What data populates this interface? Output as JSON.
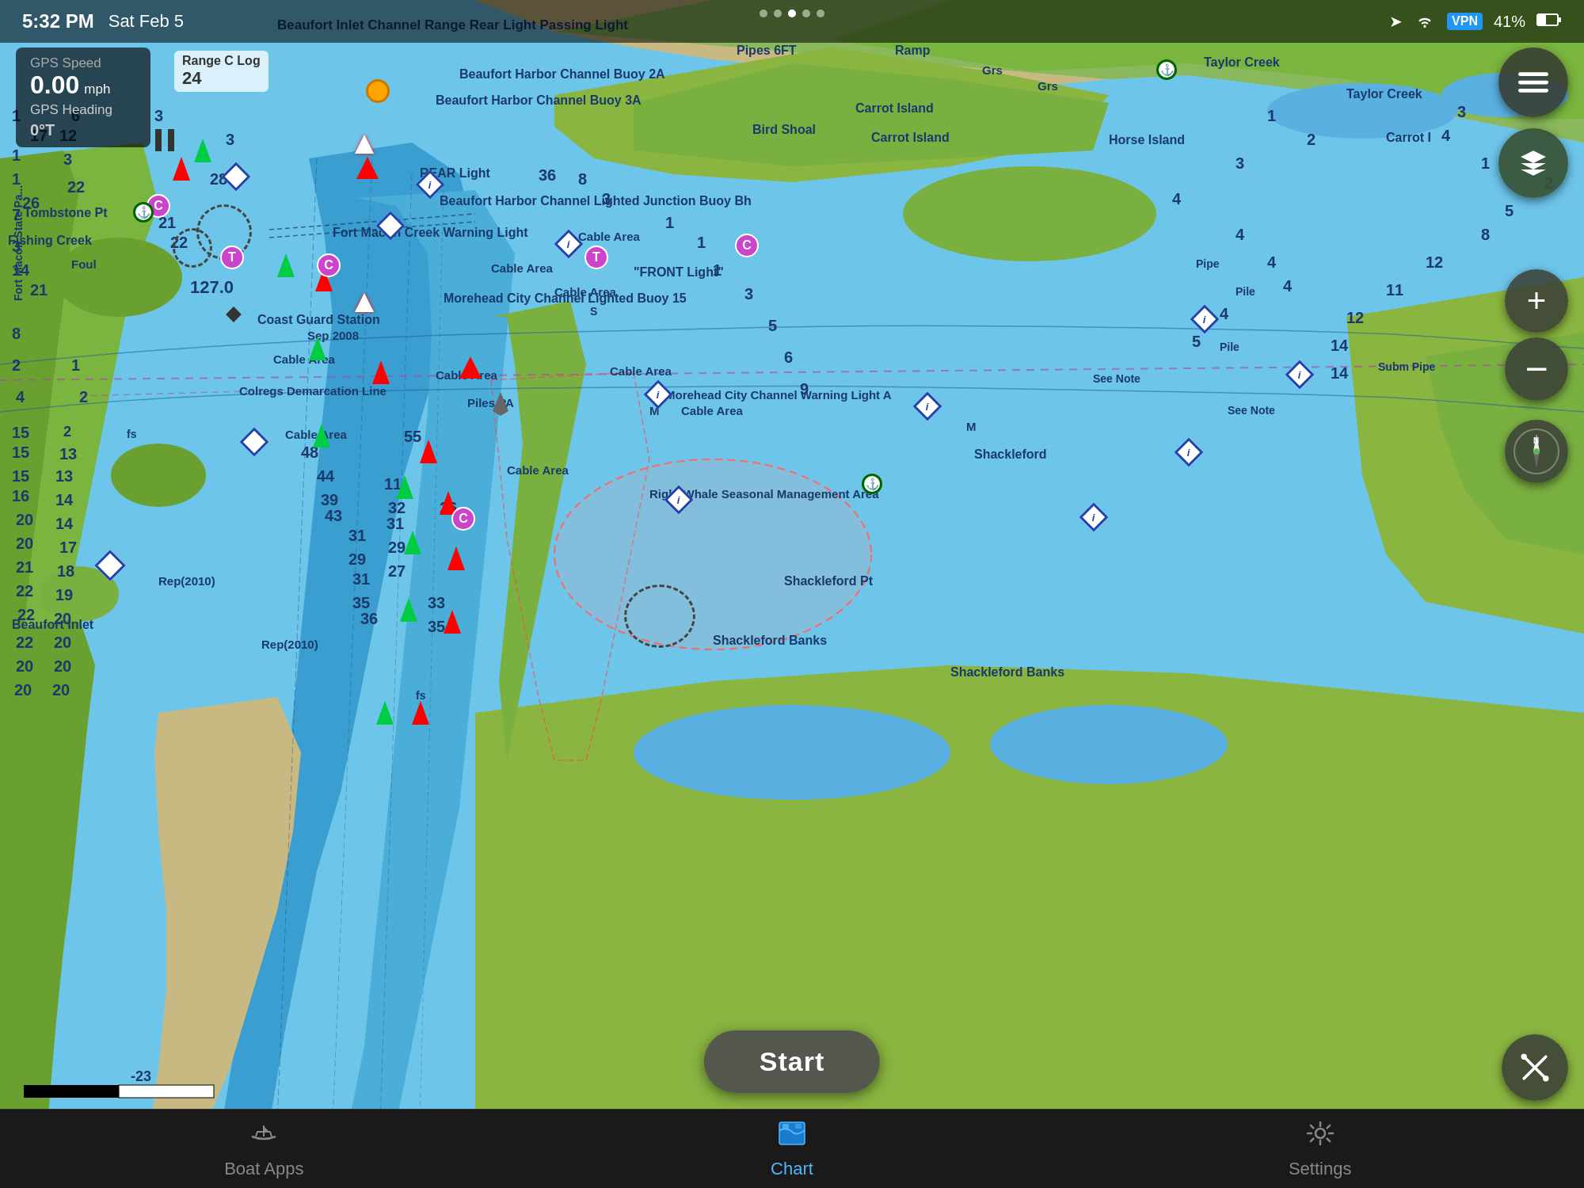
{
  "status_bar": {
    "time": "5:32 PM",
    "date": "Sat Feb 5",
    "battery": "41%",
    "vpn": "VPN"
  },
  "gps": {
    "speed_label": "GPS Speed",
    "speed_value": "0.00",
    "speed_unit": "mph",
    "heading_label": "GPS Heading",
    "heading_value": "0°T"
  },
  "range_log": {
    "label": "Range C Log",
    "value": "24"
  },
  "map": {
    "labels": [
      "Beaufort Inlet Channel Range Rear Light Passing Light",
      "Pipes  6FT",
      "Ramp",
      "Taylor Creek",
      "Taylor Creek",
      "Beaufort Harbor Channel Buoy 2A",
      "Beaufort Harbor Channel Buoy 3A",
      "Bird Shoal",
      "Carrot Island",
      "Carrot Island",
      "Horse Island",
      "Carrot I",
      "Grs",
      "Grs",
      "REAR Light",
      "Beaufort Harbor Channel Lighted Junction Buoy Bh",
      "Fort Macon Creek Warning Light",
      "Cable Area",
      "Cable Area",
      "Cable Area",
      "Pile",
      "FRONT Light",
      "Morehead City Channel Lighted Buoy 15",
      "Coast Guard Station",
      "Sep 2008",
      "Cable Area",
      "Piles PA",
      "Colregs Demarcation Line",
      "Morehead City Channel Warning Light A",
      "Cable Area",
      "Cable Area",
      "Cable Area",
      "Cable Area",
      "Right Whale Seasonal Management Area",
      "Shackleford",
      "Shackleford Pt",
      "Shackleford Banks",
      "Shackleford Banks",
      "Beaufort Inlet",
      "Rep(2010)",
      "Rep(2010)",
      "Tombstone Pt",
      "Fishing Creek",
      "Foul",
      "Fort Macon State Pa...",
      "M",
      "M",
      "S",
      "fs",
      "fs",
      "Pipe",
      "Pile",
      "See Note",
      "See Note",
      "Subm Pipe"
    ]
  },
  "controls": {
    "menu_icon": "☰",
    "layers_icon": "⊞",
    "zoom_in": "+",
    "zoom_out": "−",
    "start_label": "Start",
    "tools_icon": "✕"
  },
  "tabs": [
    {
      "id": "boat-apps",
      "label": "Boat Apps",
      "icon": "⛵",
      "active": false
    },
    {
      "id": "chart",
      "label": "Chart",
      "icon": "🗺",
      "active": true
    },
    {
      "id": "settings",
      "label": "Settings",
      "icon": "⚙",
      "active": false
    }
  ],
  "page_dots": [
    false,
    false,
    true,
    false,
    false
  ]
}
